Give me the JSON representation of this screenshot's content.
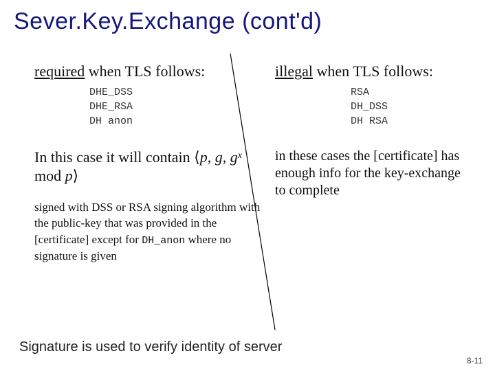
{
  "title": "Sever.Key.Exchange (cont'd)",
  "left": {
    "lead_required": "required",
    "lead_rest": " when TLS follows:",
    "ciphers": "DHE_DSS\nDHE_RSA\nDH anon",
    "case_intro": "In this case it will contain ",
    "math": "⟨p, g, gˣ mod p⟩",
    "signed": "signed with DSS or RSA signing algorithm with the public-key that was provided in the [certificate] except for ",
    "dh_anon": "DH_anon",
    "signed_tail": " where no signature is given"
  },
  "right": {
    "lead_illegal": "illegal",
    "lead_rest": " when TLS follows:",
    "ciphers": "RSA\nDH_DSS\nDH RSA",
    "note": "in these cases the [certificate] has enough info for the key-exchange to complete"
  },
  "caption": "Signature is used to verify identity of server",
  "pagenum": "8-11"
}
